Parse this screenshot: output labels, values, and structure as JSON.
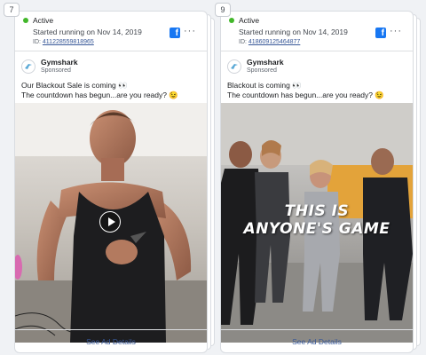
{
  "cards": [
    {
      "index": "7",
      "status": "Active",
      "started": "Started running on Nov 14, 2019",
      "id_label": "ID:",
      "id_value": "411228559818965",
      "advertiser": "Gymshark",
      "sponsored": "Sponsored",
      "body_line1": "Our Blackout Sale is coming 👀",
      "body_line2": "The countdown has begun...are you ready? 😉",
      "see_details": "See Ad Details"
    },
    {
      "index": "9",
      "status": "Active",
      "started": "Started running on Nov 14, 2019",
      "id_label": "ID:",
      "id_value": "418609125464877",
      "advertiser": "Gymshark",
      "sponsored": "Sponsored",
      "body_line1": "Blackout is coming 👀",
      "body_line2": "The countdown has begun...are you ready? 😉",
      "overlay_line1": "THIS IS",
      "overlay_line2": "ANYONE'S GAME",
      "see_details": "See Ad Details"
    }
  ],
  "icons": {
    "platform": "facebook-icon",
    "menu": "more-options-icon",
    "status": "active-dot-icon",
    "play": "play-icon"
  },
  "colors": {
    "active": "#42b72a",
    "link": "#385898",
    "facebook": "#1877f2"
  }
}
